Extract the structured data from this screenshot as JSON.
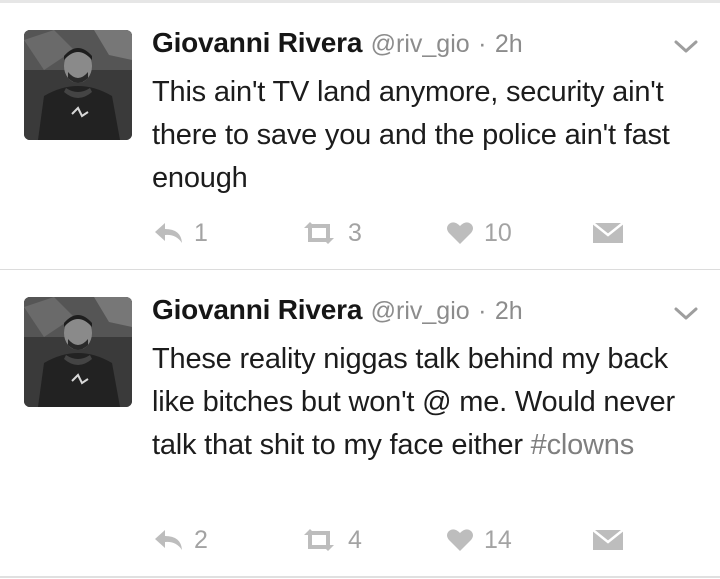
{
  "tweets": [
    {
      "author_name": "Giovanni Rivera",
      "handle": "@riv_gio",
      "separator": "·",
      "time": "2h",
      "text": "This ain't TV land anymore, security ain't there to save you and the police ain't fast enough",
      "hashtag": "",
      "reply_count": "1",
      "retweet_count": "3",
      "like_count": "10",
      "icons": {
        "menu": "chevron-down-icon",
        "reply": "reply-icon",
        "retweet": "retweet-icon",
        "like": "heart-icon",
        "dm": "envelope-icon"
      }
    },
    {
      "author_name": "Giovanni Rivera",
      "handle": "@riv_gio",
      "separator": "·",
      "time": "2h",
      "text": "These reality niggas talk behind my back like bitches but won't @ me. Would never talk that shit to my face either ",
      "hashtag": "#clowns",
      "reply_count": "2",
      "retweet_count": "4",
      "like_count": "14",
      "icons": {
        "menu": "chevron-down-icon",
        "reply": "reply-icon",
        "retweet": "retweet-icon",
        "like": "heart-icon",
        "dm": "envelope-icon"
      }
    }
  ],
  "colors": {
    "name": "#161616",
    "meta": "#8c8c8c",
    "text": "#1c1c1c",
    "hashtag": "#7f7f7f",
    "action_icon": "#bdbdbd",
    "action_count": "#a3a3a3",
    "divider": "#dcdcdc"
  }
}
